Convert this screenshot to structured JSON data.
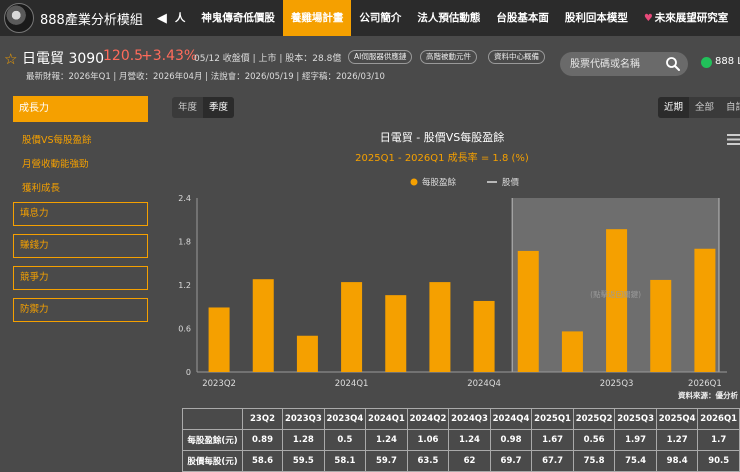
{
  "nav": {
    "brand": "888產業分析模組",
    "prev_arrow": "◀",
    "items": [
      "人",
      "神鬼傳奇低價股",
      "養雞場計畫",
      "公司簡介",
      "法人預估動態",
      "台股基本面",
      "股利回本模型",
      "未來展望研究室"
    ],
    "active_index": 2
  },
  "stock": {
    "name": "日電貿 3090",
    "price": "120.5",
    "change": "+3.43%",
    "meta": "05/12 收盤價 | 上市 | 股本：28.8億",
    "tags": [
      "AI伺服器供應鏈",
      "高階被動元件",
      "資料中心概備"
    ],
    "info": "最新財報：2026年Q1 | 月營收：2026年04月 | 法說會：2026/05/19 | 經字稿：2026/03/10",
    "price_color": "#ff6b5b"
  },
  "search": {
    "placeholder": "股票代碼或名稱"
  },
  "account": {
    "label": "888 L"
  },
  "sidebar": {
    "header": "成長力",
    "subitems": [
      "股價VS每股盈餘",
      "月營收動能強勁",
      "獲利成長"
    ],
    "sections": [
      "填息力",
      "賺錢力",
      "競爭力",
      "防禦力"
    ]
  },
  "tabs": {
    "period": [
      "年度",
      "季度"
    ],
    "period_active": 1,
    "range": [
      "近期",
      "全部",
      "自訂"
    ],
    "range_active": 0
  },
  "chart_data": {
    "type": "bar",
    "title": "日電貿 - 股價VS每股盈餘",
    "subtitle": "2025Q1 - 2026Q1 成長率 = 1.8 (%)",
    "legend": [
      {
        "name": "每股盈餘",
        "marker": "dot"
      },
      {
        "name": "股價",
        "marker": "line"
      }
    ],
    "legend_position": "top-center",
    "categories": [
      "2023Q2",
      "2023Q3",
      "2023Q4",
      "2024Q1",
      "2024Q2",
      "2024Q3",
      "2024Q4",
      "2025Q1",
      "2025Q2",
      "2025Q3",
      "2025Q4",
      "2026Q1"
    ],
    "x_tick_labels": [
      "2023Q2",
      "2024Q1",
      "2024Q4",
      "2025Q3",
      "2026Q1"
    ],
    "series": [
      {
        "name": "每股盈餘",
        "values": [
          0.89,
          1.28,
          0.5,
          1.24,
          1.06,
          1.24,
          0.98,
          1.67,
          0.56,
          1.97,
          1.27,
          1.7
        ]
      }
    ],
    "y_ticks": [
      "0",
      "0.6",
      "1.2",
      "1.8",
      "2.4"
    ],
    "ylim": [
      0,
      2.4
    ],
    "highlight_range": [
      "2025Q1",
      "2026Q1"
    ],
    "highlight_hint": "(點擊返回關鍵)",
    "grid": false,
    "source": "資料來源：優分析",
    "bar_color": "#f5a000"
  },
  "table": {
    "header_cells": [
      "23Q2",
      "2023Q3",
      "2023Q4",
      "2024Q1",
      "2024Q2",
      "2024Q3",
      "2024Q4",
      "2025Q1",
      "2025Q2",
      "2025Q3",
      "2025Q4",
      "2026Q1"
    ],
    "rows": [
      {
        "label": "每股盈餘(元)",
        "values": [
          "0.89",
          "1.28",
          "0.5",
          "1.24",
          "1.06",
          "1.24",
          "0.98",
          "1.67",
          "0.56",
          "1.97",
          "1.27",
          "1.7"
        ]
      },
      {
        "label": "股價每股(元)",
        "values": [
          "58.6",
          "59.5",
          "58.1",
          "59.7",
          "63.5",
          "62",
          "69.7",
          "67.7",
          "75.8",
          "75.4",
          "98.4",
          "90.5"
        ]
      }
    ]
  }
}
